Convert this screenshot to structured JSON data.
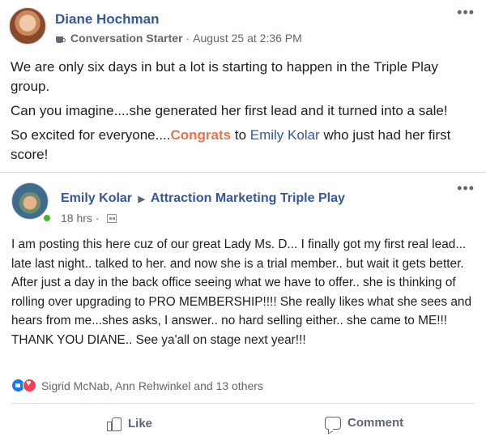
{
  "post": {
    "author": "Diane Hochman",
    "badge": "Conversation Starter",
    "timestamp": "August 25 at 2:36 PM",
    "more": "•••",
    "paragraph1": "We are only six days in but a lot is starting to happen in the Triple Play group.",
    "paragraph2": "Can you imagine....she generated her first lead and it turned into a sale!",
    "paragraph3_prefix": "So excited for everyone....",
    "paragraph3_congrats": "Congrats",
    "paragraph3_mid": " to ",
    "paragraph3_mention": "Emily Kolar",
    "paragraph3_suffix": " who just had her first score!"
  },
  "shared": {
    "author": "Emily Kolar",
    "group": "Attraction Marketing Triple Play",
    "time": "18 hrs",
    "meta_sep": "·",
    "more": "•••",
    "text": "I am posting this here cuz of our great Lady Ms. D... I finally got my first real lead... late last night.. talked to her. and now she is a trial member.. but wait it gets better. After just a day in the back office seeing what we have to offer.. she is thinking of rolling over upgrading to PRO MEMBERSHIP!!!! She really likes what she sees and hears from me...shes asks, I answer.. no hard selling either.. she came to ME!!! THANK YOU DIANE.. See ya'all on stage next year!!!",
    "reactions_text": "Sigrid McNab, Ann Rehwinkel and 13 others",
    "like_label": "Like",
    "comment_label": "Comment"
  },
  "colors": {
    "link": "#365899",
    "congrats": "#e9734a",
    "like_reaction": "#1877f2",
    "love_reaction": "#f33e58",
    "online": "#42b72a"
  },
  "icons": [
    "coffee-cup-icon",
    "calendar-icon",
    "like-reaction-icon",
    "love-reaction-icon",
    "thumbs-up-icon",
    "comment-bubble-icon",
    "more-options-icon"
  ]
}
